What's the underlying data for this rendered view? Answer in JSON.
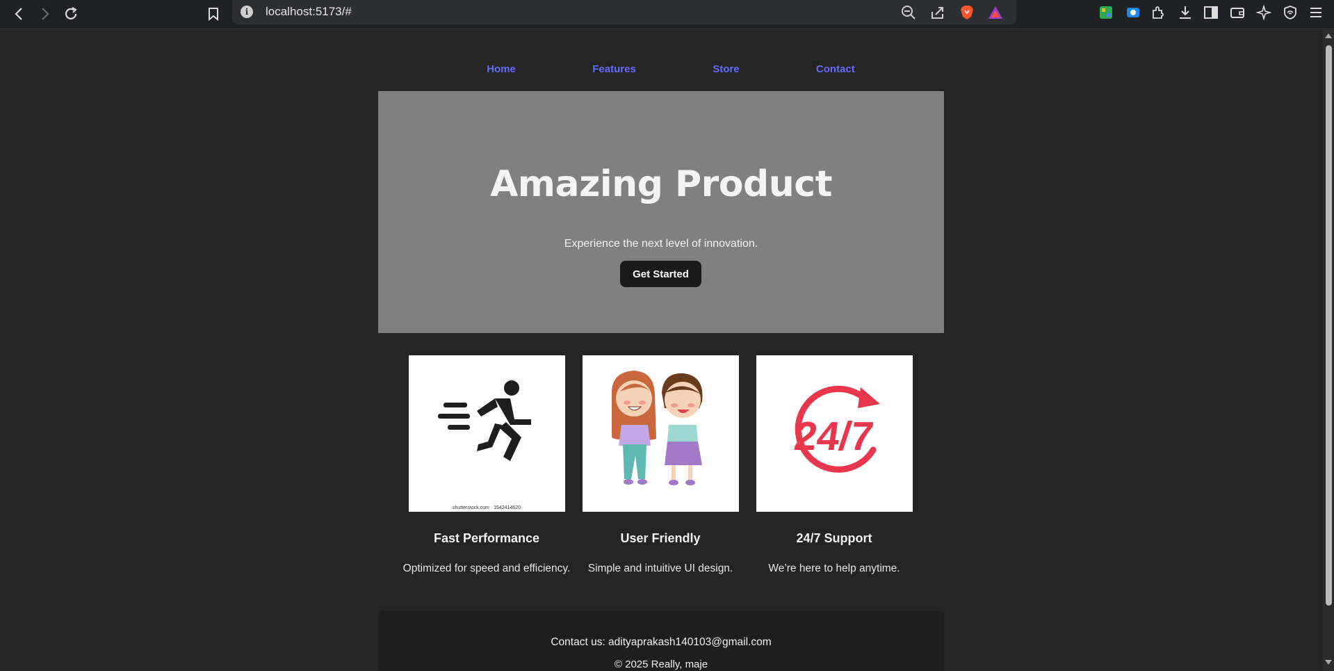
{
  "browser": {
    "url": "localhost:5173/#",
    "back_icon": "chevron-left-icon",
    "forward_icon": "chevron-right-icon",
    "reload_icon": "reload-icon"
  },
  "nav": {
    "items": [
      "Home",
      "Features",
      "Store",
      "Contact"
    ],
    "link_color": "#646cff"
  },
  "hero": {
    "title": "Amazing Product",
    "subtitle": "Experience the next level of innovation.",
    "cta": "Get Started",
    "background": "#808080"
  },
  "features": [
    {
      "title": "Fast Performance",
      "description": "Optimized for speed and efficiency.",
      "image": "running-person-icon",
      "image_credit": "shutterstock.com · 1542414620"
    },
    {
      "title": "User Friendly",
      "description": "Simple and intuitive UI design.",
      "image": "two-girls-illustration"
    },
    {
      "title": "24/7 Support",
      "description": "We’re here to help anytime.",
      "image": "24-7-icon",
      "badge_text": "24/7"
    }
  ],
  "footer": {
    "contact": "Contact us: adityaprakash140103@gmail.com",
    "copyright": "© 2025 Really, maje"
  }
}
